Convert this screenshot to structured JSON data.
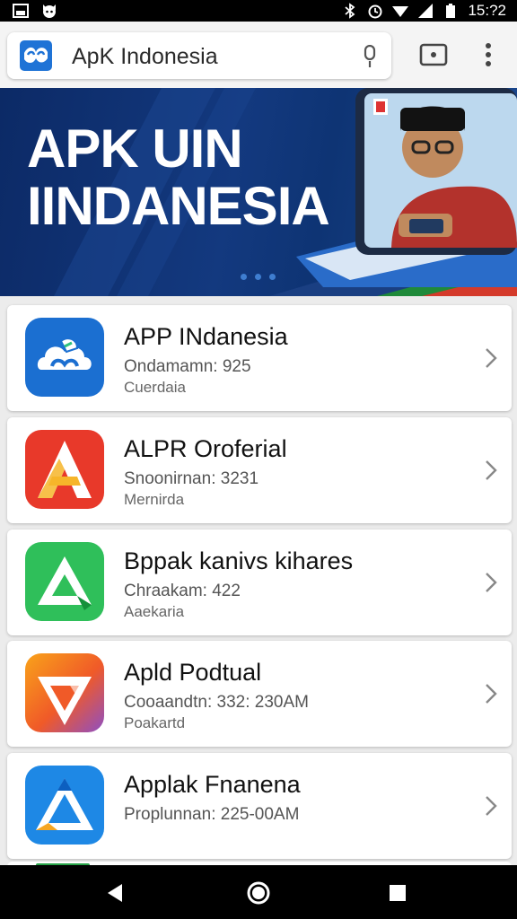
{
  "status_bar": {
    "time": "15:?2",
    "left_icons": [
      "gallery-icon",
      "cat-icon"
    ],
    "right_icons": [
      "bluetooth-icon",
      "alarm-icon",
      "wifi-icon",
      "signal-icon",
      "battery-icon"
    ]
  },
  "app_bar": {
    "search_text": "ApK Indonesia",
    "icons": [
      "app-logo-icon",
      "mic-icon",
      "tab-switcher-icon",
      "overflow-menu-icon"
    ]
  },
  "banner": {
    "title_line1": "APK UIN",
    "title_line2": "IINDANESIA",
    "colors": {
      "background": "#13397f",
      "accent": "#3f7ed0"
    }
  },
  "apps": [
    {
      "title": "APP INdanesia",
      "subtitle": "Ondamamn: 925",
      "meta": "Cuerdaia",
      "icon": "cloud-app-icon",
      "colors": [
        "#1b6fd1",
        "#0d3f9e"
      ]
    },
    {
      "title": "ALPR Oroferial",
      "subtitle": "Snoonirnan: 3231",
      "meta": "Mernirda",
      "icon": "letter-a-app-icon",
      "colors": [
        "#e8392a",
        "#f6b52a"
      ]
    },
    {
      "title": "Bppak kanivs kihares",
      "subtitle": "Chraakam: 422",
      "meta": "Aaekaria",
      "icon": "triangle-app-icon",
      "colors": [
        "#2fbf5a",
        "#15913b"
      ]
    },
    {
      "title": "Apld Podtual",
      "subtitle": "Cooaandtn: 332: 230AM",
      "meta": "Poakartd",
      "icon": "shield-app-icon",
      "colors": [
        "#f57c21",
        "#8e4fc4"
      ]
    },
    {
      "title": "Applak Fnanena",
      "subtitle": "Proplunnan: 225-00AM",
      "meta": "",
      "icon": "delta-app-icon",
      "colors": [
        "#1e88e5",
        "#0c5fc0"
      ]
    }
  ],
  "nav_bar": {
    "buttons": [
      "back-icon",
      "home-icon",
      "recents-icon"
    ]
  }
}
